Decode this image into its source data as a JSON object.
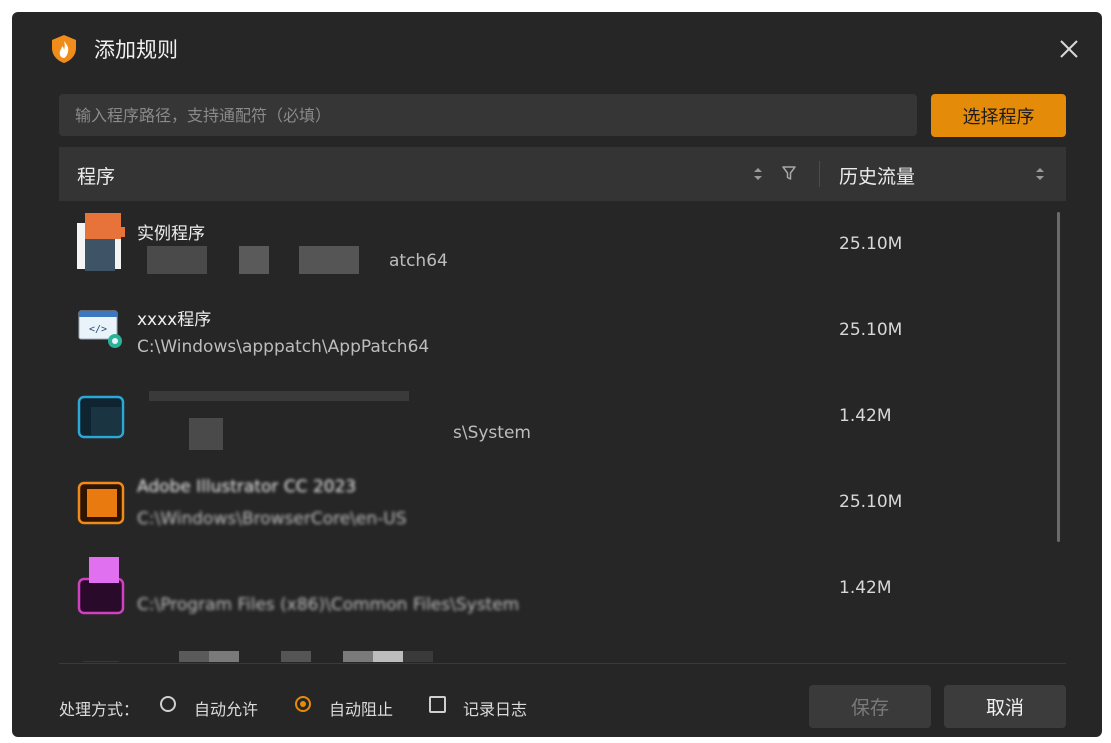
{
  "dialog": {
    "title": "添加规则",
    "close_icon": "close-icon",
    "app_icon": "flame-shield-icon"
  },
  "path_input": {
    "placeholder": "输入程序路径，支持通配符（必填）",
    "value": ""
  },
  "select_button": {
    "label": "选择程序"
  },
  "table": {
    "columns": {
      "program": "程序",
      "traffic": "历史流量"
    },
    "rows": [
      {
        "name": "实例程序",
        "path": "atch64",
        "traffic": "25.10M",
        "icon": "orange-app-icon"
      },
      {
        "name": "xxxx程序",
        "path": "C:\\Windows\\apppatch\\AppPatch64",
        "traffic": "25.10M",
        "icon": "code-settings-icon"
      },
      {
        "name": "",
        "path": "s\\System",
        "traffic": "1.42M",
        "icon": "blue-app-icon"
      },
      {
        "name": "Adobe Illustrator CC 2023",
        "path": "C:\\Windows\\BrowserCore\\en-US",
        "traffic": "25.10M",
        "icon": "illustrator-icon"
      },
      {
        "name": "",
        "path": "C:\\Program Files (x86)\\Common Files\\System",
        "traffic": "1.42M",
        "icon": "pink-app-icon"
      },
      {
        "name": "",
        "path": "",
        "traffic": "",
        "icon": "purple-app-icon"
      }
    ]
  },
  "footer": {
    "mode_label": "处理方式：",
    "options": [
      {
        "label": "自动允许",
        "checked": false
      },
      {
        "label": "自动阻止",
        "checked": true
      }
    ],
    "log_label": "记录日志",
    "log_checked": false,
    "save_label": "保存",
    "cancel_label": "取消"
  },
  "colors": {
    "accent": "#e58b0a",
    "dialog_bg": "#262626",
    "input_bg": "#363636"
  }
}
